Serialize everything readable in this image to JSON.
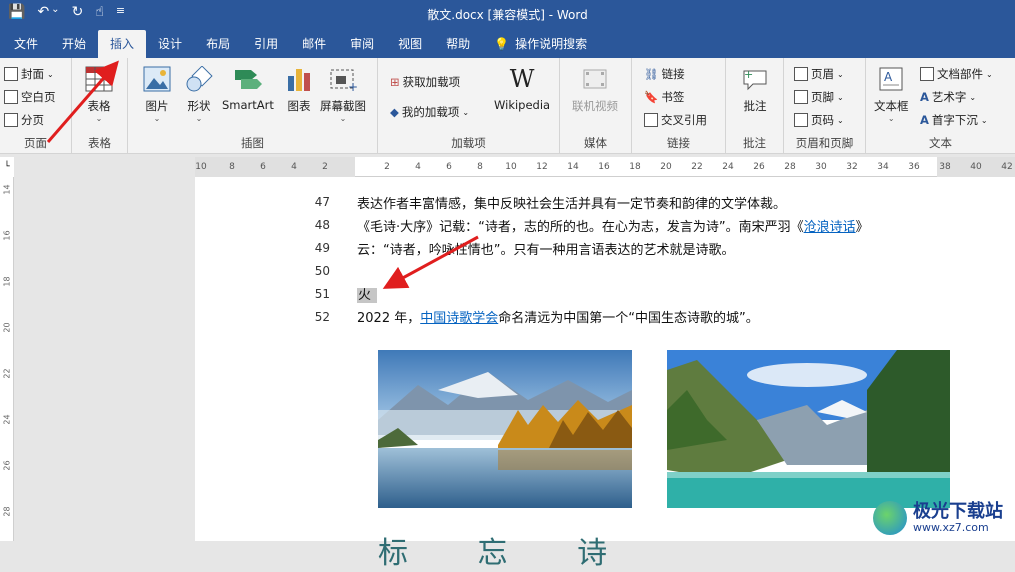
{
  "window": {
    "title": "散文.docx [兼容模式] - Word",
    "qat": {
      "save": "💾",
      "undo": "↶",
      "undo_more": "⌄",
      "redo": "↻",
      "touch": "☝",
      "customize": "≡"
    }
  },
  "tabs": [
    {
      "label": "文件"
    },
    {
      "label": "开始"
    },
    {
      "label": "插入"
    },
    {
      "label": "设计"
    },
    {
      "label": "布局"
    },
    {
      "label": "引用"
    },
    {
      "label": "邮件"
    },
    {
      "label": "审阅"
    },
    {
      "label": "视图"
    },
    {
      "label": "帮助"
    },
    {
      "label": "操作说明搜索"
    }
  ],
  "ribbon": {
    "pages": {
      "label": "页面",
      "cover": "封面",
      "blank": "空白页",
      "break": "分页"
    },
    "tables": {
      "label": "表格",
      "table": "表格"
    },
    "illustrations": {
      "label": "插图",
      "picture": "图片",
      "shapes": "形状",
      "smartart": "SmartArt",
      "chart": "图表",
      "screenshot": "屏幕截图"
    },
    "addins": {
      "label": "加载项",
      "get": "获取加载项",
      "mine": "我的加载项",
      "wikipedia": "Wikipedia"
    },
    "media": {
      "label": "媒体",
      "video": "联机视频"
    },
    "links": {
      "label": "链接",
      "link": "链接",
      "bookmark": "书签",
      "crossref": "交叉引用"
    },
    "comments": {
      "label": "批注",
      "comment": "批注"
    },
    "headerfooter": {
      "label": "页眉和页脚",
      "header": "页眉",
      "footer": "页脚",
      "pagenum": "页码"
    },
    "text": {
      "label": "文本",
      "textbox": "文本框",
      "parts": "文档部件",
      "wordart": "艺术字",
      "dropcap": "首字下沉"
    }
  },
  "ruler": {
    "ticks": [
      "10",
      "8",
      "6",
      "4",
      "2",
      "",
      "2",
      "4",
      "6",
      "8",
      "10",
      "12",
      "14",
      "16",
      "18",
      "20",
      "22",
      "24",
      "26",
      "28",
      "30",
      "32",
      "34",
      "36",
      "38",
      "40",
      "42"
    ],
    "vticks": [
      "14",
      "16",
      "18",
      "20",
      "22",
      "24",
      "26",
      "28"
    ]
  },
  "document": {
    "lines": [
      {
        "num": "47",
        "text": "表达作者丰富情感，集中反映社会生活并具有一定节奏和韵律的文学体裁。"
      },
      {
        "num": "48",
        "pre": "《毛诗·大序》记载：“诗者，志的所的也。在心为志，发言为诗”。南宋严羽《",
        "link": "沧浪诗话",
        "post": "》"
      },
      {
        "num": "49",
        "text": "云：“诗者，吟咏性情也”。只有一种用言语表达的艺术就是诗歌。"
      },
      {
        "num": "50",
        "text": ""
      },
      {
        "num": "51",
        "text": "火"
      },
      {
        "num": "52",
        "pre": "2022 年，",
        "link": "中国诗歌学会",
        "post": "命名清远为中国第一个“中国生态诗歌的城”。"
      }
    ],
    "heading_partial": "标 忘 诗"
  },
  "watermark": {
    "text": "极光下载站",
    "url": "www.xz7.com"
  }
}
